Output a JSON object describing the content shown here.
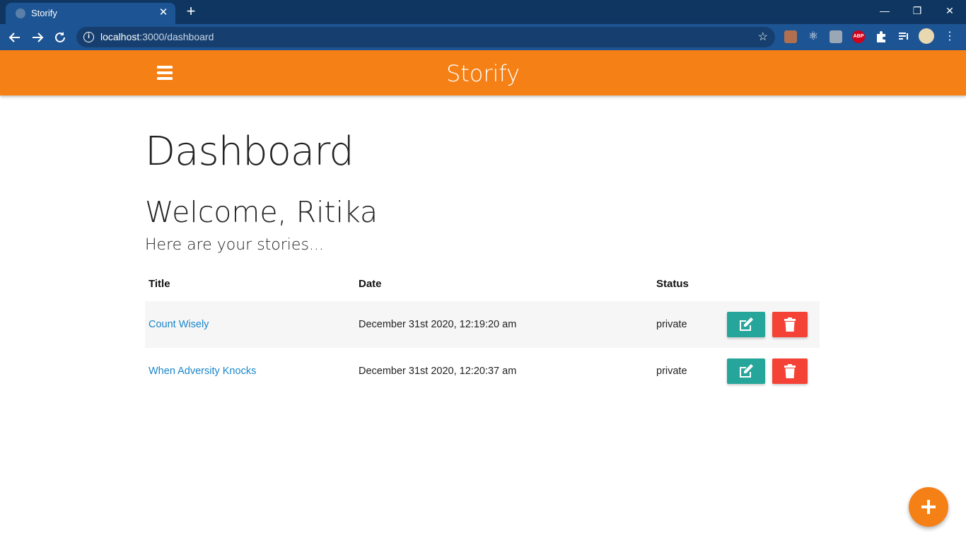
{
  "browser": {
    "tab_title": "Storify",
    "tab_close": "✕",
    "new_tab": "+",
    "url_host": "localhost",
    "url_rest": ":3000/dashboard",
    "win_minimize": "—",
    "win_restore": "❐",
    "win_close": "✕"
  },
  "navbar": {
    "brand": "Storify",
    "color": "#f58016"
  },
  "dashboard": {
    "title": "Dashboard",
    "welcome": "Welcome, Ritika",
    "subtitle": "Here are your stories..."
  },
  "table": {
    "headers": [
      "Title",
      "Date",
      "Status"
    ],
    "rows": [
      {
        "title": "Count Wisely",
        "date": "December 31st 2020, 12:19:20 am",
        "status": "private"
      },
      {
        "title": "When Adversity Knocks",
        "date": "December 31st 2020, 12:20:37 am",
        "status": "private"
      }
    ]
  },
  "colors": {
    "edit_button": "#26a69a",
    "delete_button": "#f44336",
    "link": "#1a86c8"
  },
  "icons": {
    "edit": "edit-icon",
    "delete": "trash-icon",
    "add": "plus-icon",
    "menu": "hamburger-icon"
  }
}
